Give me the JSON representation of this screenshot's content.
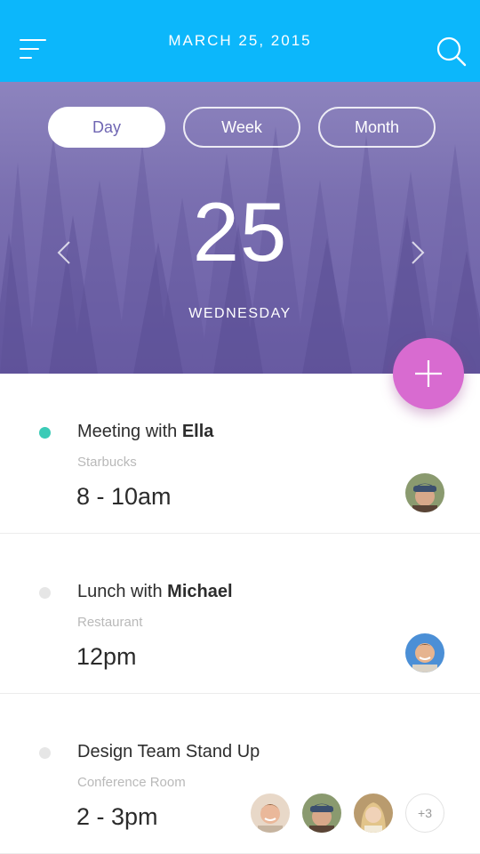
{
  "header": {
    "date_title": "MARCH 25, 2015",
    "background": "#0cb7fb",
    "menu_icon": "hamburger-menu-icon",
    "search_icon": "search-icon"
  },
  "view_toggle": {
    "options": [
      "Day",
      "Week",
      "Month"
    ],
    "selected": "Day"
  },
  "date_display": {
    "day_number": "25",
    "weekday": "WEDNESDAY",
    "prev_icon": "chevron-left-icon",
    "next_icon": "chevron-right-icon"
  },
  "add_button": {
    "icon": "plus-icon",
    "color": "#d86bd0"
  },
  "events": [
    {
      "title_prefix": "Meeting with ",
      "title_name": "Ella",
      "location": "Starbucks",
      "time": "8 - 10am",
      "dot_color": "#3ccbb7",
      "attendees": [
        "ella-avatar"
      ]
    },
    {
      "title_prefix": "Lunch with ",
      "title_name": "Michael",
      "location": "Restaurant",
      "time": "12pm",
      "dot_color": "#e6e6e6",
      "attendees": [
        "michael-avatar"
      ]
    },
    {
      "title_prefix": "Design Team Stand Up",
      "title_name": "",
      "location": "Conference Room",
      "time": "2 - 3pm",
      "dot_color": "#e6e6e6",
      "attendees": [
        "attendee-1-avatar",
        "attendee-2-avatar",
        "attendee-3-avatar"
      ],
      "more_count": "+3"
    }
  ]
}
